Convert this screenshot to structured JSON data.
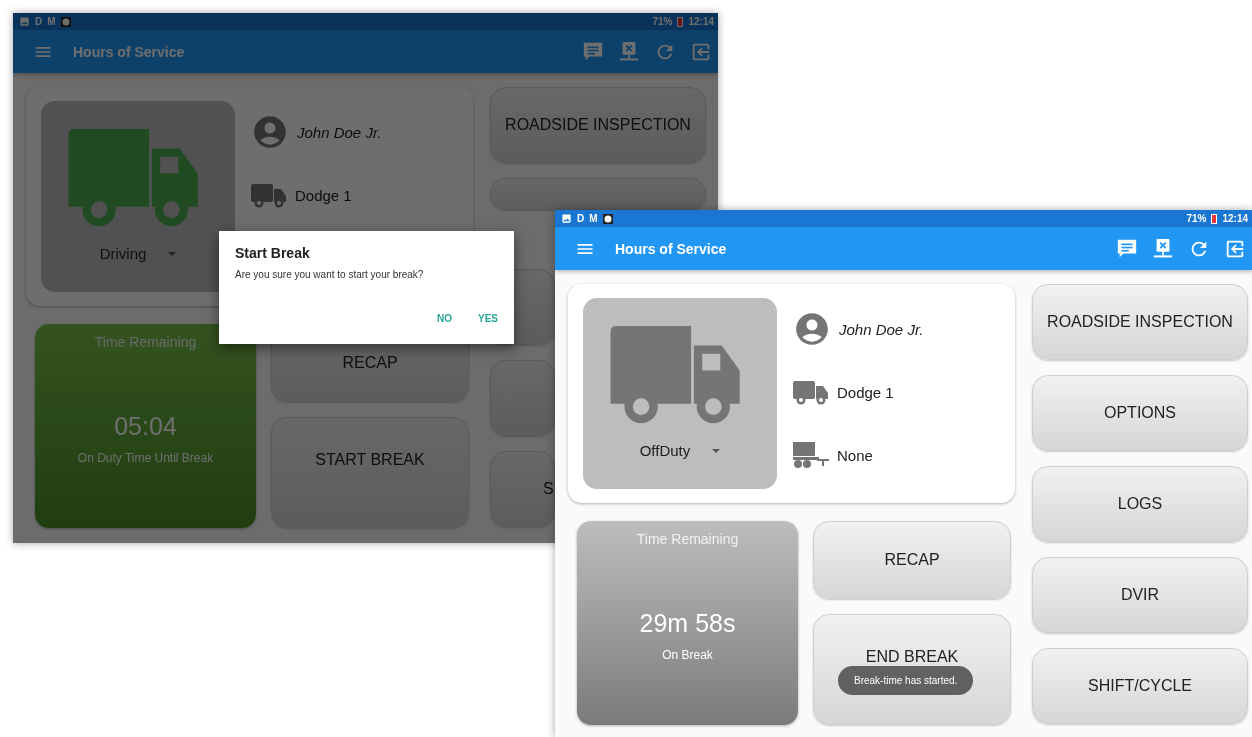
{
  "screens": [
    {
      "dimmed": true,
      "kind": "driving",
      "status_bar": {
        "letters": [
          "D",
          "M"
        ],
        "battery": "71%",
        "time": "12:14"
      },
      "app_bar": {
        "title": "Hours of Service"
      },
      "status_select": {
        "value": "Driving"
      },
      "info_rows": [
        {
          "kind": "driver",
          "text": "John Doe Jr."
        },
        {
          "kind": "vehicle",
          "text": "Dodge 1"
        }
      ],
      "time_panel": {
        "title": "Time Remaining",
        "value": "05:04",
        "caption": "On Duty Time Until Break"
      },
      "middle_buttons": [
        {
          "label": "RECAP"
        },
        {
          "label": "START BREAK"
        }
      ],
      "right_buttons": [
        {
          "kind": "full",
          "label": "ROADSIDE INSPECTION"
        },
        {
          "kind": "top_strip"
        },
        {
          "kind": "left_strip"
        },
        {
          "kind": "left_strip"
        },
        {
          "kind": "left_strip",
          "label": "S"
        }
      ],
      "dialog": {
        "title": "Start Break",
        "message": "Are you sure you want to start your break?",
        "buttons": [
          "NO",
          "YES"
        ]
      }
    },
    {
      "dimmed": false,
      "kind": "off_duty",
      "status_bar": {
        "letters": [
          "D",
          "M"
        ],
        "battery": "71%",
        "time": "12:14"
      },
      "app_bar": {
        "title": "Hours of Service"
      },
      "status_select": {
        "value": "OffDuty"
      },
      "info_rows": [
        {
          "kind": "driver",
          "text": "John Doe Jr."
        },
        {
          "kind": "vehicle",
          "text": "Dodge 1"
        },
        {
          "kind": "trailer",
          "text": "None"
        }
      ],
      "time_panel": {
        "title": "Time Remaining",
        "value": "29m 58s",
        "caption": "On Break"
      },
      "middle_buttons": [
        {
          "label": "RECAP"
        },
        {
          "label": "END BREAK"
        }
      ],
      "right_buttons": [
        {
          "label": "ROADSIDE INSPECTION"
        },
        {
          "label": "OPTIONS"
        },
        {
          "label": "LOGS"
        },
        {
          "label": "DVIR"
        },
        {
          "label": "SHIFT/CYCLE"
        }
      ],
      "toast": {
        "text": "Break-time has started."
      }
    }
  ]
}
